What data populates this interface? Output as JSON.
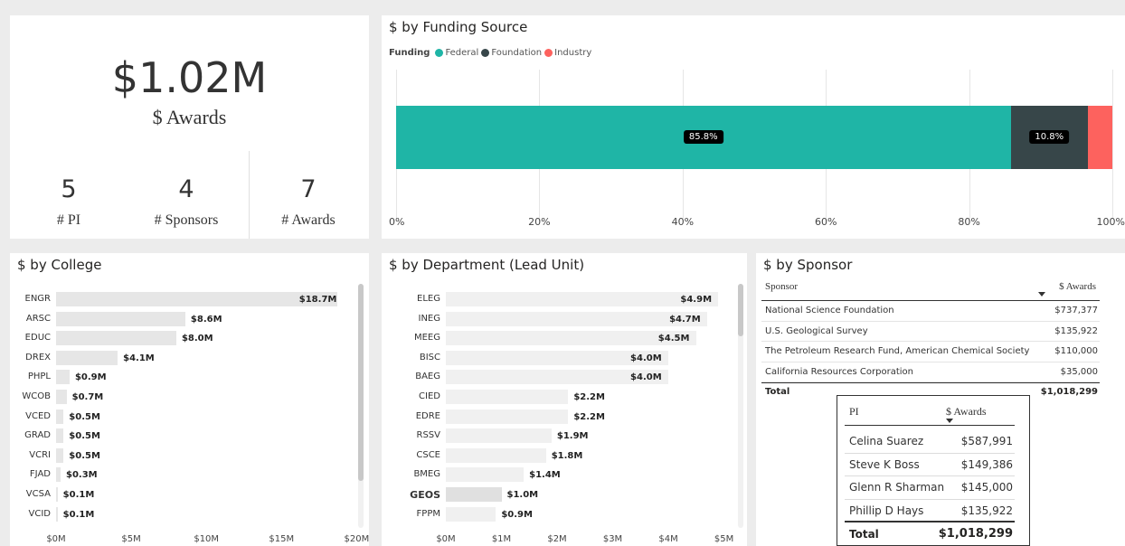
{
  "kpi": {
    "total_value": "$1.02M",
    "total_label": "$ Awards",
    "cards": [
      {
        "value": "5",
        "label": "# PI"
      },
      {
        "value": "4",
        "label": "# Sponsors"
      },
      {
        "value": "7",
        "label": "# Awards"
      }
    ]
  },
  "funding": {
    "title": "$ by Funding Source",
    "legend_title": "Funding",
    "legend": [
      {
        "name": "Federal",
        "color": "#1fb5a6"
      },
      {
        "name": "Foundation",
        "color": "#374649"
      },
      {
        "name": "Industry",
        "color": "#fd625e"
      }
    ],
    "axis_ticks": [
      "0%",
      "20%",
      "40%",
      "60%",
      "80%",
      "100%"
    ],
    "data_labels": [
      "85.8%",
      "10.8%"
    ]
  },
  "chart_data": [
    {
      "type": "bar",
      "orientation": "horizontal",
      "stacked": "100%",
      "title": "$ by Funding Source",
      "categories": [
        "Funding"
      ],
      "series": [
        {
          "name": "Federal",
          "values": [
            85.8
          ]
        },
        {
          "name": "Foundation",
          "values": [
            10.8
          ]
        },
        {
          "name": "Industry",
          "values": [
            3.4
          ]
        }
      ],
      "xlim": [
        0,
        100
      ],
      "legend": "top-left"
    },
    {
      "type": "bar",
      "orientation": "horizontal",
      "title": "$ by College",
      "categories": [
        "ENGR",
        "ARSC",
        "EDUC",
        "DREX",
        "PHPL",
        "WCOB",
        "VCED",
        "GRAD",
        "VCRI",
        "FJAD",
        "VCSA",
        "VCID"
      ],
      "values": [
        18.7,
        8.6,
        8.0,
        4.1,
        0.9,
        0.7,
        0.5,
        0.5,
        0.5,
        0.3,
        0.1,
        0.1
      ],
      "labels": [
        "$18.7M",
        "$8.6M",
        "$8.0M",
        "$4.1M",
        "$0.9M",
        "$0.7M",
        "$0.5M",
        "$0.5M",
        "$0.5M",
        "$0.3M",
        "$0.1M",
        "$0.1M"
      ],
      "xlim": [
        0,
        21
      ],
      "xticks": [
        "$0M",
        "$5M",
        "$10M",
        "$15M",
        "$20M"
      ]
    },
    {
      "type": "bar",
      "orientation": "horizontal",
      "title": "$ by Department (Lead Unit)",
      "categories": [
        "ELEG",
        "INEG",
        "MEEG",
        "BISC",
        "BAEG",
        "CIED",
        "EDRE",
        "RSSV",
        "CSCE",
        "BMEG",
        "GEOS",
        "FPPM"
      ],
      "values": [
        4.9,
        4.7,
        4.5,
        4.0,
        4.0,
        2.2,
        2.2,
        1.9,
        1.8,
        1.4,
        1.0,
        0.9
      ],
      "labels": [
        "$4.9M",
        "$4.7M",
        "$4.5M",
        "$4.0M",
        "$4.0M",
        "$2.2M",
        "$2.2M",
        "$1.9M",
        "$1.8M",
        "$1.4M",
        "$1.0M",
        "$0.9M"
      ],
      "highlighted": "GEOS",
      "xlim": [
        0,
        5.3
      ],
      "xticks": [
        "$0M",
        "$1M",
        "$2M",
        "$3M",
        "$4M",
        "$5M"
      ]
    }
  ],
  "college": {
    "title": "$ by College"
  },
  "department": {
    "title": "$ by Department (Lead Unit)"
  },
  "sponsor": {
    "title": "$ by Sponsor",
    "col_sponsor": "Sponsor",
    "col_awards": "$ Awards",
    "rows": [
      {
        "name": "National Science Foundation",
        "value": "$737,377"
      },
      {
        "name": "U.S. Geological Survey",
        "value": "$135,922"
      },
      {
        "name": "The Petroleum Research Fund, American Chemical Society",
        "value": "$110,000"
      },
      {
        "name": "California Resources Corporation",
        "value": "$35,000"
      }
    ],
    "total_label": "Total",
    "total_value": "$1,018,299"
  },
  "pi": {
    "col_pi": "PI",
    "col_awards": "$ Awards",
    "rows": [
      {
        "name": "Celina Suarez",
        "value": "$587,991"
      },
      {
        "name": "Steve K Boss",
        "value": "$149,386"
      },
      {
        "name": "Glenn R Sharman",
        "value": "$145,000"
      },
      {
        "name": "Phillip D Hays",
        "value": "$135,922"
      }
    ],
    "total_label": "Total",
    "total_value": "$1,018,299"
  }
}
